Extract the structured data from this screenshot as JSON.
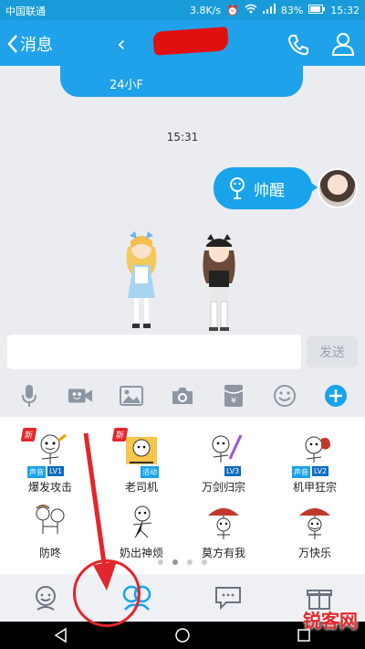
{
  "status_bar": {
    "carrier": "中国联通",
    "net_speed": "3.8K/s",
    "battery": "83%",
    "time": "15:32"
  },
  "header": {
    "back_label": "消息"
  },
  "chat": {
    "prev_message_fragment": "24小F",
    "timestamp": "15:31",
    "my_message": "帅醒"
  },
  "input": {
    "placeholder": "",
    "send_label": "发送"
  },
  "toolbar": {
    "items": [
      "microphone-icon",
      "video-icon",
      "image-icon",
      "camera-icon",
      "red-packet-icon",
      "emoji-icon",
      "plus-icon"
    ],
    "accent": "#19a3ea"
  },
  "emoticons": [
    {
      "label": "爆发攻击",
      "badge": "新",
      "tags": [
        "声音",
        "LV1"
      ]
    },
    {
      "label": "老司机",
      "badge": "新",
      "tags": [
        "活动"
      ]
    },
    {
      "label": "万剑归宗",
      "badge": "",
      "tags": [
        "LV3"
      ]
    },
    {
      "label": "机甲狂宗",
      "badge": "",
      "tags": [
        "声音",
        "LV2"
      ]
    },
    {
      "label": "防咚",
      "badge": "",
      "tags": []
    },
    {
      "label": "奶出神烦",
      "badge": "",
      "tags": []
    },
    {
      "label": "莫方有我",
      "badge": "",
      "tags": []
    },
    {
      "label": "万快乐",
      "badge": "",
      "tags": []
    }
  ],
  "page_dots": {
    "count": 4,
    "active": 1
  },
  "bottom_tabs": [
    "smile-face-icon",
    "couple-icon",
    "chat-bubble-icon",
    "gift-box-icon"
  ],
  "watermark": "锐客网"
}
